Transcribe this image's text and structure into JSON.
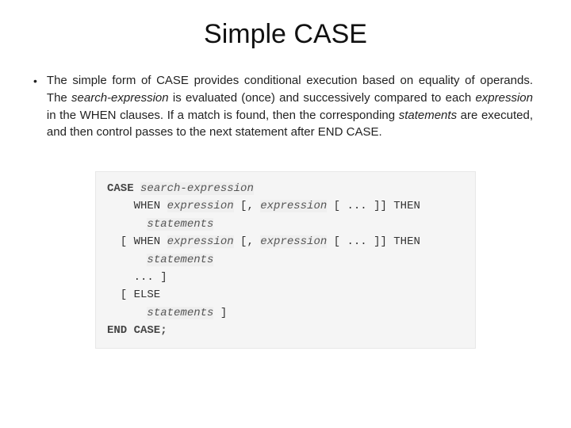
{
  "title": "Simple CASE",
  "bullet": "•",
  "para": {
    "p1": "The simple form of ",
    "kw1": "CASE",
    "p2": " provides conditional execution based on equality of operands. The ",
    "it1": "search-expression",
    "p3": " is evaluated (once) and successively compared to each ",
    "it2": "expression",
    "p4": " in the WHEN clauses. If a match is found, then the corresponding ",
    "it3": "statements",
    "p5": " are executed, and then control passes to the next statement after END CASE."
  },
  "code": {
    "l1a": "CASE ",
    "l1b": "search-expression",
    "l2a": "    WHEN ",
    "l2b": "expression",
    "l2c": " [, ",
    "l2d": "expression",
    "l2e": " [ ... ]] THEN",
    "l3a": "      ",
    "l3b": "statements",
    "l4a": "  [ WHEN ",
    "l4b": "expression",
    "l4c": " [, ",
    "l4d": "expression",
    "l4e": " [ ... ]] THEN",
    "l5a": "      ",
    "l5b": "statements",
    "l6": "    ... ]",
    "l7": "  [ ELSE",
    "l8a": "      ",
    "l8b": "statements",
    "l8c": " ]",
    "l9": "END CASE;"
  }
}
